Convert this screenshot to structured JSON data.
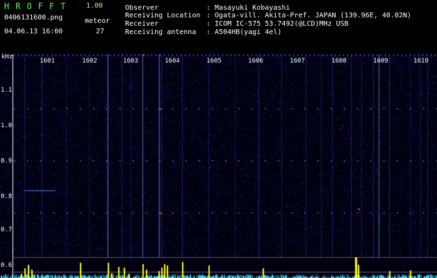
{
  "header": {
    "app_title": "HROFFT",
    "app_version": "1.00",
    "file_name": "0406131600.png",
    "meteor_label": "meteor",
    "meteor_count": "27",
    "date_time": "04.06.13 16:00"
  },
  "info": [
    {
      "key": "Observer",
      "value": ": Masayuki Kobayashi"
    },
    {
      "key": "Receiving Location",
      "value": ": Ogata-vill. Akita-Pref. JAPAN (139.96E, 40.02N)"
    },
    {
      "key": "Receiver",
      "value": ": ICOM IC-575 53.7492(@LCD)MHz USB"
    },
    {
      "key": "Receiving antenna",
      "value": ": A504HB(yagi 4el)"
    }
  ],
  "spectrogram": {
    "y_unit": "kHz",
    "y_ticks": [
      "1.1",
      "1.0",
      "0.9",
      "0.8",
      "0.7",
      "0.6"
    ],
    "x_ticks": [
      "1601",
      "1602",
      "1603",
      "1604",
      "1605",
      "1606",
      "1607",
      "1608",
      "1609",
      "1610"
    ],
    "colors": {
      "background": "#000010",
      "noise": "#1a2a9a",
      "signal": "#80e8ff",
      "meteor": "#ff3030",
      "histogram": "#ffff00",
      "histogram_low": "#30d0ff"
    }
  }
}
